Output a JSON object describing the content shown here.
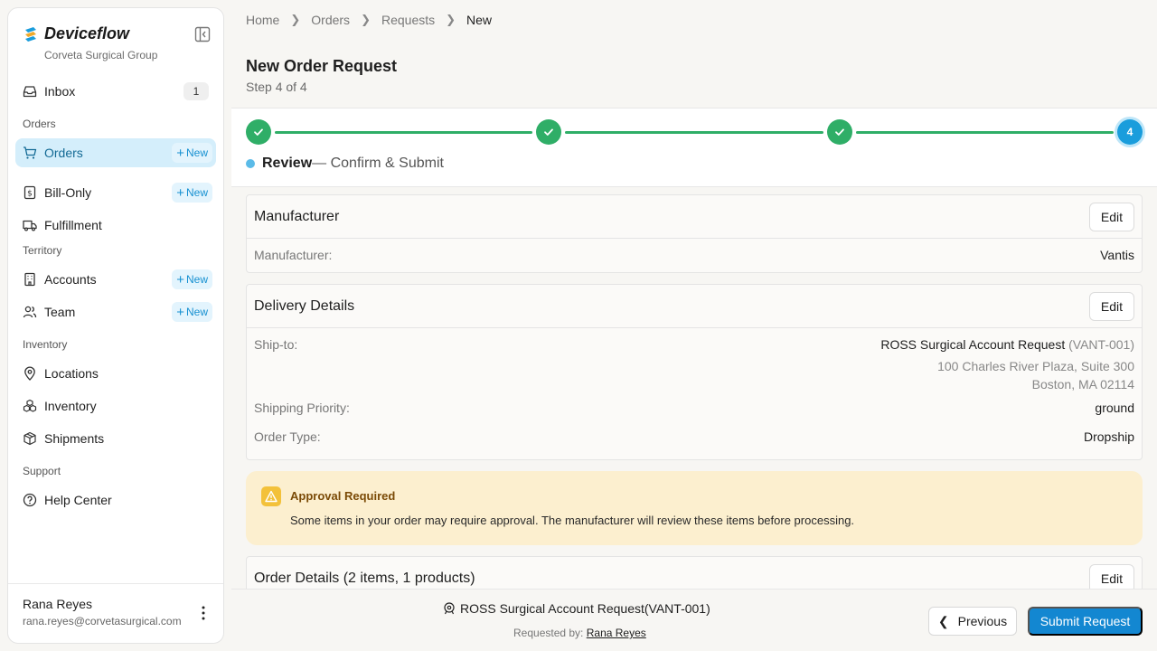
{
  "sidebar": {
    "brand": "Deviceflow",
    "org": "Corveta Surgical Group",
    "inbox": {
      "label": "Inbox",
      "count": "1"
    },
    "sections": {
      "orders": "Orders",
      "territory": "Territory",
      "inventory": "Inventory",
      "support": "Support"
    },
    "items": {
      "orders": {
        "label": "Orders",
        "new": "New"
      },
      "bill_only": {
        "label": "Bill-Only",
        "new": "New"
      },
      "fulfillment": {
        "label": "Fulfillment"
      },
      "accounts": {
        "label": "Accounts",
        "new": "New"
      },
      "team": {
        "label": "Team",
        "new": "New"
      },
      "locations": {
        "label": "Locations"
      },
      "inventory": {
        "label": "Inventory"
      },
      "shipments": {
        "label": "Shipments"
      },
      "help": {
        "label": "Help Center"
      }
    },
    "user": {
      "name": "Rana Reyes",
      "email": "rana.reyes@corvetasurgical.com"
    }
  },
  "breadcrumb": [
    "Home",
    "Orders",
    "Requests",
    "New"
  ],
  "page": {
    "title": "New Order Request",
    "step": "Step 4 of 4"
  },
  "stepper": {
    "current_number": "4",
    "current_label": "Review",
    "current_desc": "— Confirm & Submit",
    "completed_steps": 3,
    "total_steps": 4
  },
  "manufacturer": {
    "title": "Manufacturer",
    "edit": "Edit",
    "label": "Manufacturer:",
    "value": "Vantis"
  },
  "delivery": {
    "title": "Delivery Details",
    "edit": "Edit",
    "ship_to_label": "Ship-to:",
    "ship_to_name": "ROSS Surgical Account Request",
    "ship_to_code": "(VANT-001)",
    "address_line1": "100 Charles River Plaza, Suite 300",
    "address_line2": "Boston, MA 02114",
    "priority_label": "Shipping Priority:",
    "priority_value": "ground",
    "order_type_label": "Order Type:",
    "order_type_value": "Dropship"
  },
  "alert": {
    "title": "Approval Required",
    "text": "Some items in your order may require approval. The manufacturer will review these items before processing."
  },
  "order_details": {
    "title": "Order Details (2 items, 1 products)",
    "edit": "Edit"
  },
  "footer": {
    "account": "ROSS Surgical Account Request(VANT-001)",
    "requested_by_label": "Requested by:",
    "requested_by": "Rana Reyes",
    "previous": "Previous",
    "submit": "Submit Request"
  },
  "colors": {
    "accent": "#1387d1",
    "success": "#2fae67",
    "warning_bg": "#fcefcf"
  }
}
